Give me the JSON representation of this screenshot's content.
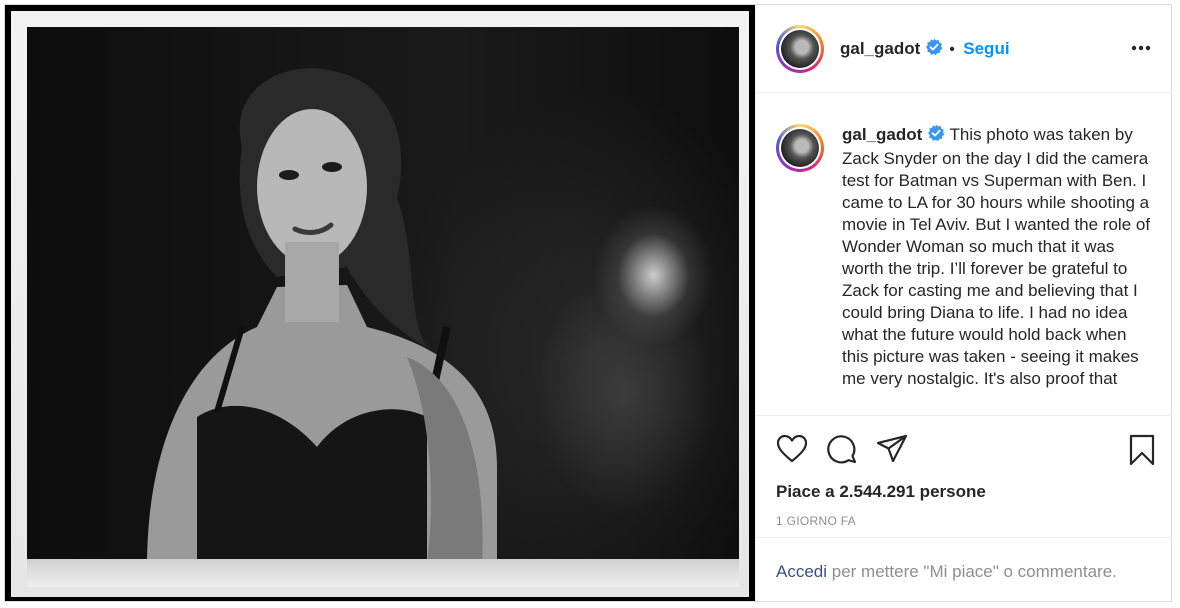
{
  "header": {
    "username": "gal_gadot",
    "separator": "•",
    "follow_label": "Segui"
  },
  "caption": {
    "username": "gal_gadot",
    "text": "This photo was taken by Zack Snyder on the day I did the camera test for Batman vs Superman with Ben. I came to LA for 30 hours while shooting a movie in Tel Aviv. But I wanted the role of Wonder Woman so much that it was worth the trip. I’ll forever be grateful to Zack for casting me and believing that I could bring Diana to life. I had no idea what the future would hold back when this picture was taken - seeing it makes me very nostalgic. It's also proof that"
  },
  "actions": {
    "likes": "Piace a 2.544.291 persone",
    "timestamp": "1 GIORNO FA"
  },
  "login_bar": {
    "login_link": "Accedi",
    "rest": "per mettere \"Mi piace\" o commentare."
  },
  "icons": {
    "verified": "verified-badge-icon",
    "more": "more-options-icon",
    "like": "heart-icon",
    "comment": "comment-bubble-icon",
    "share": "paper-plane-icon",
    "save": "bookmark-icon"
  },
  "colors": {
    "accent": "#0095f6",
    "link": "#385185",
    "text": "#262626",
    "muted": "#8e8e8e"
  }
}
